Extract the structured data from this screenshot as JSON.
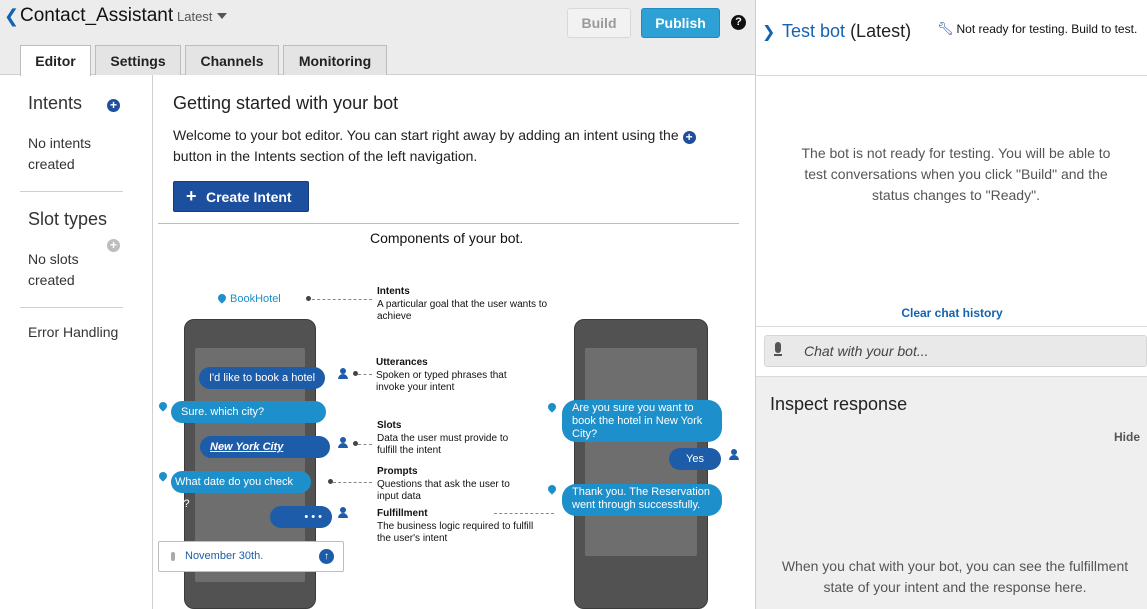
{
  "header": {
    "bot_name": "Contact_Assistant",
    "version": "Latest",
    "build_label": "Build",
    "publish_label": "Publish",
    "help_glyph": "?"
  },
  "tabs": [
    {
      "label": "Editor",
      "active": true
    },
    {
      "label": "Settings",
      "active": false
    },
    {
      "label": "Channels",
      "active": false
    },
    {
      "label": "Monitoring",
      "active": false
    }
  ],
  "sidebar": {
    "intents_heading": "Intents",
    "no_intents": "No intents created",
    "slot_types_heading": "Slot types",
    "no_slots": "No slots created",
    "error_handling": "Error Handling"
  },
  "main": {
    "title": "Getting started with your bot",
    "welcome_part1": "Welcome to your bot editor. You can start right away by adding an intent using the",
    "welcome_part2": "button in the Intents section of the left navigation.",
    "create_intent_label": "Create Intent",
    "diagram_title": "Components of your bot."
  },
  "diagram": {
    "intent_name": "BookHotel",
    "left_phone": {
      "messages": [
        "I'd like to book a hotel",
        "Sure. which city?",
        "New York City",
        "What date do you check in?",
        "• • •"
      ],
      "input_value": "November 30th."
    },
    "right_phone": {
      "messages": [
        "Are you sure you want to book the hotel in New York City?",
        "Yes",
        "Thank you. The Reservation went through successfully."
      ]
    },
    "legend": [
      {
        "title": "Intents",
        "desc": "A particular goal that the user wants to achieve"
      },
      {
        "title": "Utterances",
        "desc": "Spoken or typed phrases that invoke your intent"
      },
      {
        "title": "Slots",
        "desc": "Data the user must provide to fulfill the intent"
      },
      {
        "title": "Prompts",
        "desc": "Questions that ask the user to input data"
      },
      {
        "title": "Fulfillment",
        "desc": "The business logic required to fulfill the user's intent"
      }
    ]
  },
  "test_panel": {
    "title": "Test bot",
    "version": "(Latest)",
    "status": "Not ready for testing. Build to test.",
    "not_ready_message": "The bot is not ready for testing. You will be able to test conversations when you click \"Build\" and the status changes to \"Ready\".",
    "clear_history_label": "Clear chat history",
    "chat_placeholder": "Chat with your bot...",
    "inspect_title": "Inspect response",
    "hide_label": "Hide",
    "inspect_message": "When you chat with your bot, you can see the fulfillment state of your intent and the response here."
  },
  "colors": {
    "accent_blue": "#1462b0",
    "publish_blue": "#2da1d6",
    "create_intent_blue": "#1d4f9f",
    "bubble_dark": "#1d5ca8",
    "bubble_light": "#1d8fca"
  }
}
